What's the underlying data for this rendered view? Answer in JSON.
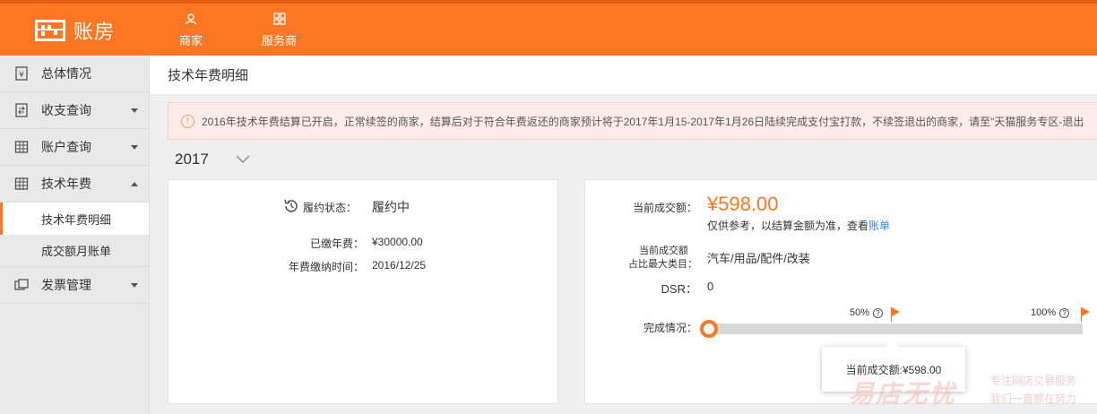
{
  "app": {
    "logo_text": "账房"
  },
  "topnav": [
    {
      "label": "商家",
      "icon": "user-icon"
    },
    {
      "label": "服务商",
      "icon": "grid-icon"
    }
  ],
  "sidebar": {
    "items": [
      {
        "label": "总体情况",
        "icon": "yen-doc-icon"
      },
      {
        "label": "收支查询",
        "icon": "exchange-doc-icon"
      },
      {
        "label": "账户查询",
        "icon": "table-icon"
      },
      {
        "label": "技术年费",
        "icon": "table-icon"
      },
      {
        "label": "发票管理",
        "icon": "invoice-icon"
      }
    ],
    "subitems": [
      {
        "label": "技术年费明细"
      },
      {
        "label": "成交额月账单"
      }
    ]
  },
  "page": {
    "title": "技术年费明细",
    "notice": "2016年技术年费结算已开启，正常续签的商家，结算后对于符合年费返还的商家预计将于2017年1月15-2017年1月26日陆续完成支付宝打款，不续签退出的商家，请至\"天猫服务专区-退出",
    "year": "2017"
  },
  "left_card": {
    "status_label": "履约状态：",
    "status_value": "履约中",
    "paid_label": "已缴年费：",
    "paid_value": "¥30000.00",
    "time_label": "年费缴纳时间：",
    "time_value": "2016/12/25"
  },
  "right_card": {
    "amount_label": "当前成交额：",
    "amount_value": "¥598.00",
    "note_text": "仅供参考，以结算金额为准，查看",
    "note_link": "账单",
    "category_label_1": "当前成交额",
    "category_label_2": "占比最大类目：",
    "category_value": "汽车/用品/配件/改装",
    "dsr_label": "DSR：",
    "dsr_value": "0",
    "progress_label": "完成情况：",
    "progress_fraction": 0.0,
    "marker_50": "50%",
    "marker_100": "100%",
    "tooltip": "当前成交额:¥598.00"
  },
  "watermark": {
    "brand": "易店无忧",
    "slogan_1": "专注网店交易服务",
    "slogan_2": "我们一直都在努力"
  },
  "colors": {
    "brand": "#ff7722",
    "link": "#3d87d6"
  }
}
